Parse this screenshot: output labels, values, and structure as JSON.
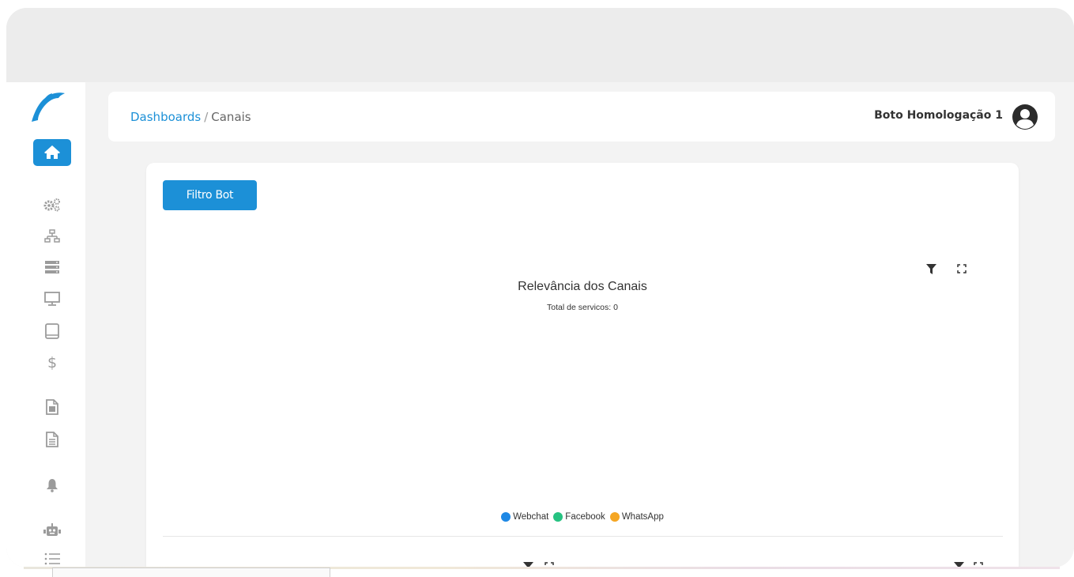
{
  "header": {
    "breadcrumb": {
      "root": "Dashboards",
      "separator": "/",
      "current": "Canais"
    },
    "user_name": "Boto Homologação 1"
  },
  "sidebar": {
    "items": [
      {
        "icon": "home-icon",
        "active": true
      },
      {
        "icon": "gears-icon"
      },
      {
        "icon": "network-icon"
      },
      {
        "icon": "server-icon"
      },
      {
        "icon": "monitor-icon"
      },
      {
        "icon": "tablet-icon"
      },
      {
        "icon": "dollar-icon",
        "glyph": "$"
      },
      {
        "icon": "invoice-icon"
      },
      {
        "icon": "document-icon"
      },
      {
        "icon": "bell-icon"
      },
      {
        "icon": "robot-icon"
      },
      {
        "icon": "list-icon"
      }
    ]
  },
  "card": {
    "filter_button_label": "Filtro Bot"
  },
  "chart_data": {
    "type": "pie",
    "title": "Relevância dos Canais",
    "subtitle": "Total de servicos: 0",
    "series": [
      {
        "name": "Webchat",
        "value": 0,
        "color": "#1e88e5"
      },
      {
        "name": "Facebook",
        "value": 0,
        "color": "#26c281"
      },
      {
        "name": "WhatsApp",
        "value": 0,
        "color": "#f5a623"
      }
    ],
    "legend_position": "bottom"
  },
  "colors": {
    "accent": "#1c90d7",
    "background": "#ececec"
  }
}
